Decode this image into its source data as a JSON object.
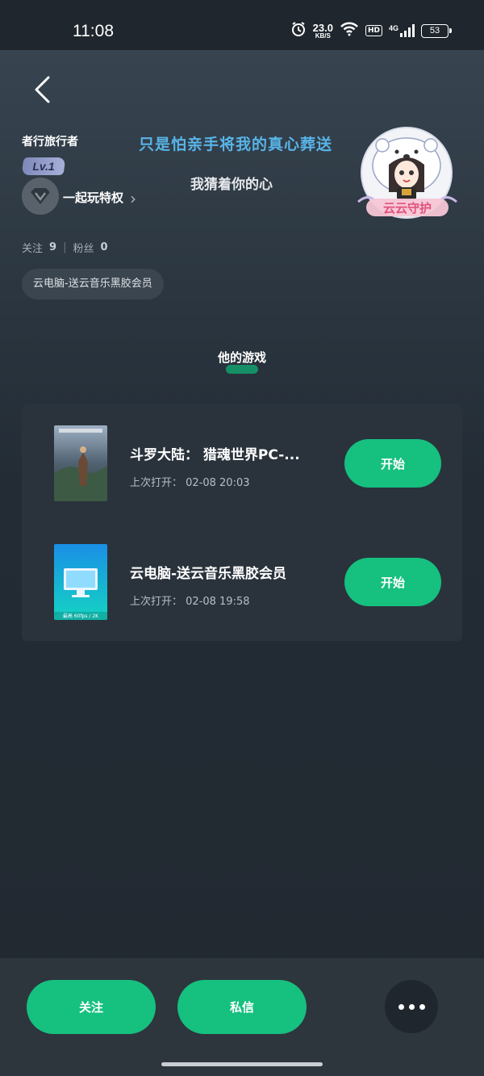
{
  "status_bar": {
    "time": "11:08",
    "net_speed_value": "23.0",
    "net_speed_unit": "KB/S",
    "hd_label": "HD",
    "network_label": "4G",
    "battery": "53"
  },
  "profile": {
    "username": "者行旅行者",
    "level": "Lv.1",
    "vip_label": "一起玩特权",
    "signature_line1": "只是怕亲手将我的真心葬送",
    "signature_line2": "我猜着你的心",
    "follow_label": "关注",
    "follow_count": "9",
    "fans_label": "粉丝",
    "fans_count": "0",
    "tag": "云电脑-送云音乐黑胶会员"
  },
  "tab": {
    "title": "他的游戏"
  },
  "games": [
    {
      "name": "斗罗大陆： 猎魂世界PC-...",
      "last_open": "上次打开：  02-08  20:03",
      "button": "开始"
    },
    {
      "name": "云电脑-送云音乐黑胶会员",
      "last_open": "上次打开：  02-08  19:58",
      "button": "开始"
    }
  ],
  "bottom_actions": {
    "follow": "关注",
    "message": "私信"
  },
  "colors": {
    "accent": "#16c07f",
    "signature_blue": "#58b4e7"
  }
}
